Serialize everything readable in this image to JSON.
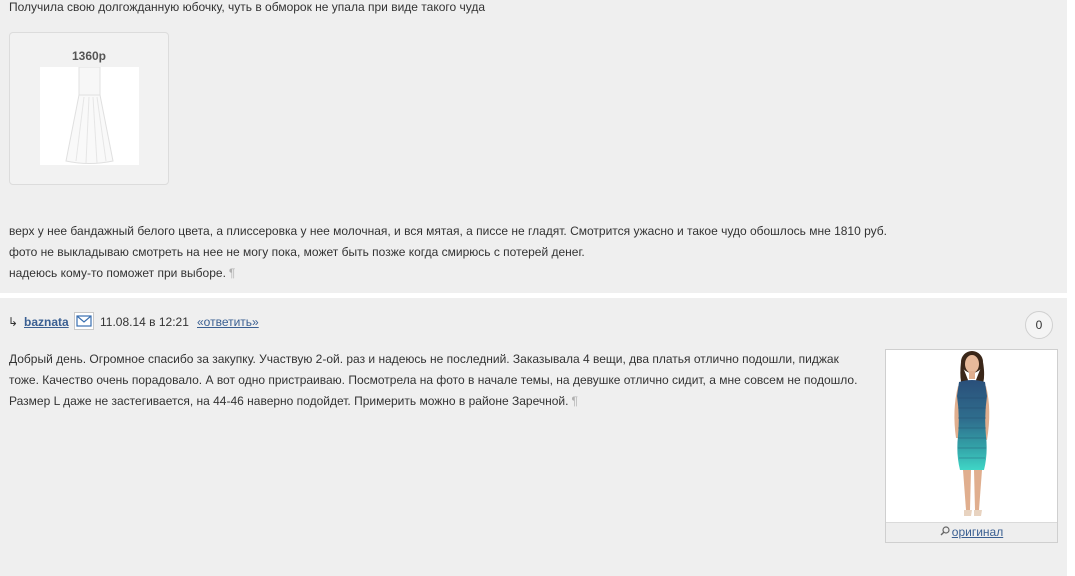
{
  "post1": {
    "intro": "Получила свою долгожданную юбочку, чуть в обморок не упала при виде такого чуда",
    "product": {
      "price": "1360р",
      "image": "white-pleated-skirt"
    },
    "lines": [
      "верх у нее бандажный белого цвета, а плиссеровка у нее молочная, и вся мятая, а писсе не гладят. Смотрится ужасно и такое чудо обошлось мне 1810 руб.",
      "фото не выкладываю смотреть на нее не могу пока, может быть позже когда смирюсь с потерей денег.",
      "надеюсь кому-то поможет при выборе."
    ],
    "pilcrow": "¶"
  },
  "comment": {
    "reply_arrow": "↳",
    "author": "baznata",
    "mail_icon": "envelope-icon",
    "date": "11.08.14 в 12:21",
    "reply_label": "«ответить»",
    "rating": "0",
    "lines": [
      "Добрый день. Огромное спасибо за закупку. Участвую 2-ой. раз и надеюсь не последний. Заказывала 4 вещи, два платья отлично подошли, пиджак",
      "тоже. Качество очень порадовало. А вот одно пристраиваю. Посмотрела на фото в начале темы, на девушке отлично сидит, а мне совсем не подошло.",
      "Размер L даже не застегивается, на 44-46 наверно подойдет. Примерить можно в районе Заречной."
    ],
    "pilcrow": "¶",
    "photo": {
      "image": "woman-in-ombre-bandage-dress",
      "original_label": "оригинал"
    }
  },
  "colors": {
    "post_background": "#efefef",
    "link": "#3a5f92",
    "text": "#333333",
    "dress_top": "#2a4f7a",
    "dress_bottom": "#3fd6c6"
  }
}
